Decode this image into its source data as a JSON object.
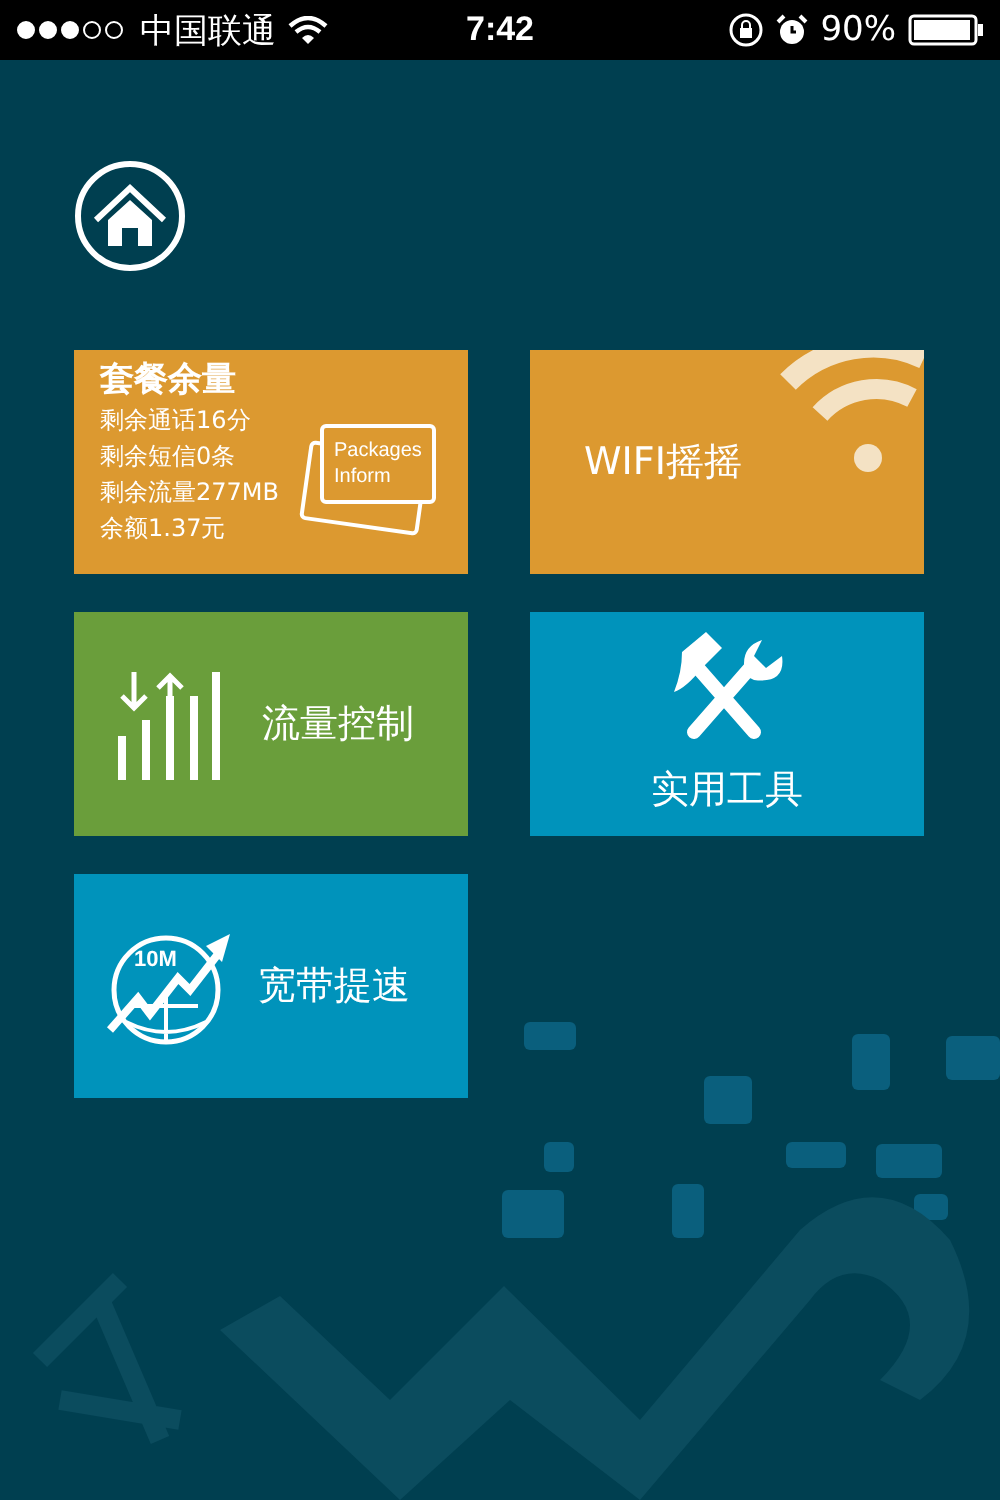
{
  "status_bar": {
    "carrier": "中国联通",
    "time": "7:42",
    "battery": "90%"
  },
  "tiles": [
    {
      "kind": "package",
      "title": "套餐余量",
      "lines": [
        "剩余通话16分",
        "剩余短信0条",
        "剩余流量277MB",
        "余额1.37元"
      ],
      "icon_text": [
        "Packages",
        "Inform"
      ],
      "color": "#dc9930"
    },
    {
      "kind": "wifi",
      "title": "WIFI摇摇",
      "color": "#dc9930"
    },
    {
      "kind": "traffic",
      "title": "流量控制",
      "color": "#6a9e3b"
    },
    {
      "kind": "tools",
      "title": "实用工具",
      "color": "#0093bb"
    },
    {
      "kind": "speed",
      "title": "宽带提速",
      "icon_text": [
        "10M"
      ],
      "color": "#0093bb"
    }
  ]
}
